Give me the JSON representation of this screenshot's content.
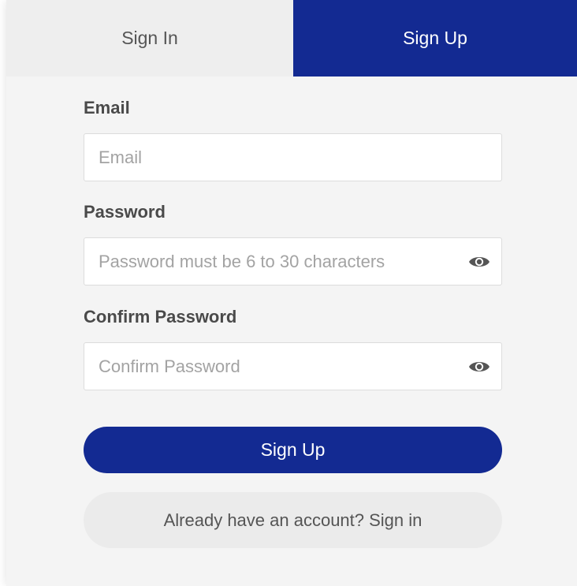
{
  "tabs": {
    "sign_in": "Sign In",
    "sign_up": "Sign Up",
    "active": "sign_up"
  },
  "form": {
    "email": {
      "label": "Email",
      "placeholder": "Email",
      "value": ""
    },
    "password": {
      "label": "Password",
      "placeholder": "Password must be 6 to 30 characters",
      "value": "",
      "toggle_icon": "eye-icon"
    },
    "confirm_password": {
      "label": "Confirm Password",
      "placeholder": "Confirm Password",
      "value": "",
      "toggle_icon": "eye-icon"
    },
    "submit_label": "Sign Up",
    "switch_label": "Already have an account? Sign in"
  },
  "colors": {
    "brand": "#132a92",
    "panel_bg": "#f4f4f4",
    "inactive_tab_bg": "#eeeeee",
    "label_text": "#4a4a4a"
  }
}
